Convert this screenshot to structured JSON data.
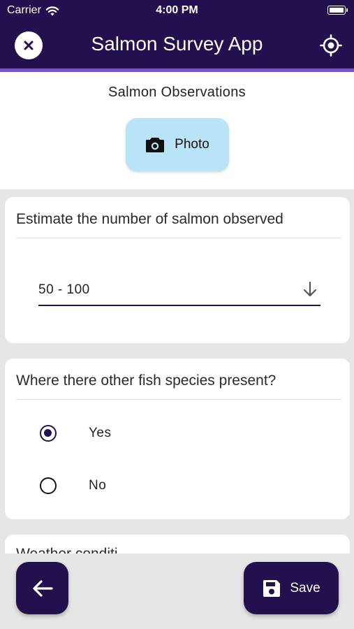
{
  "status_bar": {
    "carrier": "Carrier",
    "time": "4:00 PM"
  },
  "app_bar": {
    "title": "Salmon Survey App",
    "close_icon": "close-icon",
    "locate_icon": "gps-locate-icon"
  },
  "header": {
    "section_title": "Salmon Observations",
    "photo_button_label": "Photo",
    "photo_icon": "camera-icon"
  },
  "questions": {
    "salmon_count": {
      "question": "Estimate the number of salmon observed",
      "selected_value": "50 - 100"
    },
    "other_species": {
      "question": "Where there other fish species present?",
      "options": [
        {
          "label": "Yes",
          "selected": true
        },
        {
          "label": "No",
          "selected": false
        }
      ]
    },
    "weather": {
      "question_partial": "Weather conditi..."
    }
  },
  "footer": {
    "back_icon": "arrow-left-icon",
    "save_label": "Save",
    "save_icon": "floppy-disk-icon"
  },
  "colors": {
    "primary": "#23104f",
    "accent": "#7a52c9",
    "photo_button": "#b9e3f6",
    "background": "#e6e6e6"
  }
}
